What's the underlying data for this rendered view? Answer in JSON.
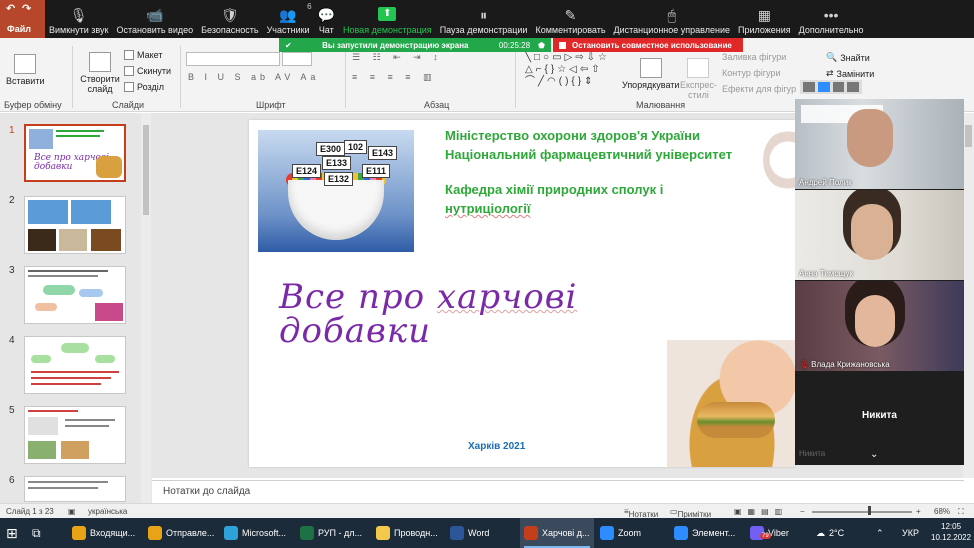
{
  "ppt": {
    "file_tab": "Файл",
    "ribbon": {
      "paste": "Вставити",
      "clipboard_group": "Буфер обміну",
      "new_slide": "Створити\nслайд",
      "layout": "Макет",
      "reset": "Скинути",
      "section": "Розділ",
      "slides_group": "Слайди",
      "font_group": "Шрифт",
      "paragraph_group": "Абзац",
      "arrange": "Упорядкувати",
      "express_styles": "Експрес-\nстилі",
      "shape_fill": "Заливка фігури",
      "shape_outline": "Контур фігури",
      "shape_effects": "Ефекти для фігур",
      "drawing_group": "Малювання",
      "find": "Знайти",
      "replace": "Замінити"
    },
    "thumbnails": [
      "1",
      "2",
      "3",
      "4",
      "5",
      "6"
    ],
    "slide": {
      "ministry": "Міністерство охорони здоров'я України",
      "university": "Національний фармацевтичний університет",
      "dept_line1": "Кафедра хімії природних сполук і",
      "dept_line2": "нутриціології",
      "title_line1_a": "Все про ",
      "title_line1_b": "харчові",
      "title_line2": "добавки",
      "city": "Харків 2021",
      "e_codes": [
        "E300",
        "102",
        "E143",
        "E133",
        "E124",
        "E111",
        "E132"
      ]
    },
    "notes_placeholder": "Нотатки до слайда",
    "status": {
      "slide_counter": "Слайд 1 з 23",
      "language": "українська",
      "notes_btn": "Нотатки",
      "comments_btn": "Примітки",
      "zoom": "68%"
    }
  },
  "zoom": {
    "toolbar": [
      {
        "label": "Вимкнути звук",
        "icon": "microphone-icon",
        "glyph": "🎙"
      },
      {
        "label": "Остановить видео",
        "icon": "video-camera-icon",
        "glyph": "📹"
      },
      {
        "label": "Безопасность",
        "icon": "shield-icon",
        "glyph": "🛡"
      },
      {
        "label": "Участники",
        "icon": "participants-icon",
        "glyph": "👥",
        "count": "6"
      },
      {
        "label": "Чат",
        "icon": "chat-icon",
        "glyph": "💬"
      },
      {
        "label": "Новая демонстрация",
        "icon": "share-screen-icon",
        "glyph": "⬆",
        "accent": true
      },
      {
        "label": "Пауза демонстрации",
        "icon": "pause-icon",
        "glyph": "⏸"
      },
      {
        "label": "Комментировать",
        "icon": "annotate-icon",
        "glyph": "✎"
      },
      {
        "label": "Дистанционное управление",
        "icon": "remote-control-icon",
        "glyph": "🖱"
      },
      {
        "label": "Приложения",
        "icon": "apps-icon",
        "glyph": "▦"
      },
      {
        "label": "Дополнительно",
        "icon": "more-icon",
        "glyph": "•••"
      }
    ],
    "share_banner": "Вы запустили демонстрацию экрана",
    "share_timer": "00:25:28",
    "stop_share": "Остановить совместное использование",
    "participants": [
      {
        "name": "Андрей Полик"
      },
      {
        "name": "Анна Тимощук"
      },
      {
        "name": "Влада Крижановська",
        "muted": true
      },
      {
        "name": "Никита"
      },
      {
        "name": "Никита"
      }
    ]
  },
  "taskbar": {
    "items": [
      {
        "label": "Входящи...",
        "icon": "chrome-icon",
        "color": "#e8a317"
      },
      {
        "label": "Отправле...",
        "icon": "chrome-icon",
        "color": "#e8a317"
      },
      {
        "label": "Microsoft...",
        "icon": "edge-icon",
        "color": "#2ea3d9"
      },
      {
        "label": "РУП - дл...",
        "icon": "excel-icon",
        "color": "#1e7145"
      },
      {
        "label": "Проводн...",
        "icon": "folder-icon",
        "color": "#f2c94c"
      },
      {
        "label": "Word",
        "icon": "word-icon",
        "color": "#2b579a"
      },
      {
        "label": "Харчові д...",
        "icon": "powerpoint-icon",
        "color": "#c43e1c",
        "active": true
      },
      {
        "label": "Zoom",
        "icon": "zoom-icon",
        "color": "#2d8cff"
      },
      {
        "label": "Элемент...",
        "icon": "zoom-icon",
        "color": "#2d8cff"
      },
      {
        "label": "Viber",
        "icon": "viber-icon",
        "color": "#7360f2",
        "badge": "79"
      }
    ],
    "weather": "2°C",
    "lang": "УКР",
    "time": "12:05",
    "date": "10.12.2022"
  }
}
